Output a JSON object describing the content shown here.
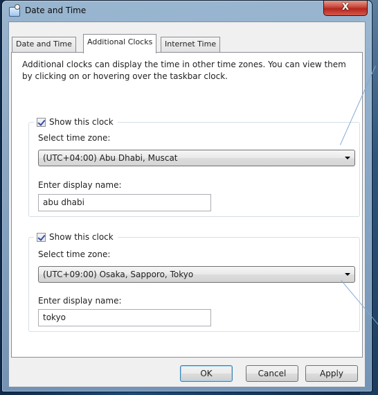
{
  "window": {
    "title": "Date and Time",
    "close_label": "X"
  },
  "tabs": [
    {
      "label": "Date and Time",
      "active": false
    },
    {
      "label": "Additional Clocks",
      "active": true
    },
    {
      "label": "Internet Time",
      "active": false
    }
  ],
  "intro_text": "Additional clocks can display the time in other time zones. You can view them by clicking on or hovering over the taskbar clock.",
  "clocks": [
    {
      "show_label": "Show this clock",
      "checked": true,
      "timezone_label": "Select time zone:",
      "timezone_value": "(UTC+04:00) Abu Dhabi, Muscat",
      "display_name_label": "Enter display name:",
      "display_name_value": "abu dhabi"
    },
    {
      "show_label": "Show this clock",
      "checked": true,
      "timezone_label": "Select time zone:",
      "timezone_value": "(UTC+09:00) Osaka, Sapporo, Tokyo",
      "display_name_label": "Enter display name:",
      "display_name_value": "tokyo"
    }
  ],
  "buttons": {
    "ok": "OK",
    "cancel": "Cancel",
    "apply": "Apply"
  }
}
